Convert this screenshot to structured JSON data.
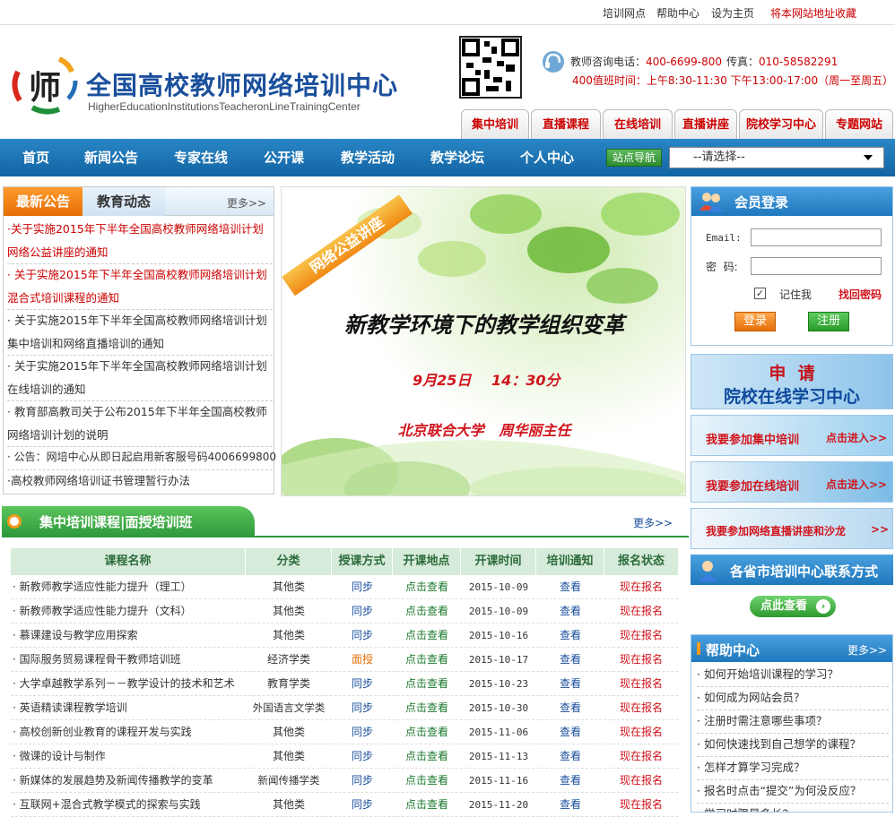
{
  "topbar": {
    "links": [
      "培训网点",
      "帮助中心",
      "设为主页"
    ],
    "bookmark": "将本网站地址收藏"
  },
  "header": {
    "logo_char": "师",
    "title": "全国高校教师网络培训中心",
    "subtitle": "HigherEducationInstitutionsTeacheronLineTrainingCenter",
    "phone_label": "教师咨询电话：",
    "phone": "400-6699-800",
    "fax_label": "传真：",
    "fax": "010-58582291",
    "hours_label": "400值班时间：",
    "hours": "上午8:30-11:30  下午13:00-17:00（周一至周五）"
  },
  "top_tabs": [
    "集中培训",
    "直播课程",
    "在线培训",
    "直播讲座",
    "院校学习中心",
    "专题网站"
  ],
  "nav": {
    "items": [
      "首页",
      "新闻公告",
      "专家在线",
      "公开课",
      "教学活动",
      "教学论坛",
      "个人中心"
    ],
    "site_nav_button": "站点导航",
    "select_value": "--请选择--"
  },
  "news": {
    "tab_active": "最新公告",
    "tab_inactive": "教育动态",
    "more": "更多>>",
    "items": [
      {
        "text": "·关于实施2015年下半年全国高校教师网络培训计划网络公益讲座的通知",
        "red": true
      },
      {
        "text": "· 关于实施2015年下半年全国高校教师网络培训计划混合式培训课程的通知",
        "red": true
      },
      {
        "text": "· 关于实施2015年下半年全国高校教师网络培训计划集中培训和网络直播培训的通知",
        "red": false
      },
      {
        "text": "· 关于实施2015年下半年全国高校教师网络培训计划在线培训的通知",
        "red": false
      },
      {
        "text": "· 教育部高教司关于公布2015年下半年全国高校教师网络培训计划的说明",
        "red": false
      },
      {
        "text": "· 公告：网培中心从即日起启用新客服号码4006699800",
        "red": false
      },
      {
        "text": "·高校教师网络培训证书管理暂行办法",
        "red": false
      }
    ]
  },
  "banner": {
    "ribbon": "网络公益讲座",
    "title": "新教学环境下的教学组织变革",
    "date": "9月25日",
    "time": "14：30分",
    "speaker": "北京联合大学   周华丽主任"
  },
  "login": {
    "title": "会员登录",
    "email_label": "Email:",
    "password_label": "密  码:",
    "remember_label": "记住我",
    "forgot_link": "找回密码",
    "login_button": "登录",
    "register_button": "注册"
  },
  "promos": {
    "apply_line1": "申  请",
    "apply_line2": "院校在线学习中心",
    "join_central": "我要参加集中培训",
    "join_online": "我要参加在线培训",
    "click_enter": "点击进入>>",
    "join_live": "我要参加网络直播讲座和沙龙",
    "arrows": ">>",
    "provinces_title": "各省市培训中心联系方式",
    "view_button": "点此查看"
  },
  "courses": {
    "heading": "集中培训课程|面授培训班",
    "more": "更多>>",
    "columns": [
      "课程名称",
      "分类",
      "授课方式",
      "开课地点",
      "开课时间",
      "培训通知",
      "报名状态"
    ],
    "rows": [
      {
        "name": "· 新教师教学适应性能力提升（理工）",
        "category": "其他类",
        "mode": "同步",
        "place": "点击查看",
        "date": "2015-10-09",
        "notice": "查看",
        "status": "现在报名"
      },
      {
        "name": "· 新教师教学适应性能力提升（文科）",
        "category": "其他类",
        "mode": "同步",
        "place": "点击查看",
        "date": "2015-10-09",
        "notice": "查看",
        "status": "现在报名"
      },
      {
        "name": "· 慕课建设与教学应用探索",
        "category": "其他类",
        "mode": "同步",
        "place": "点击查看",
        "date": "2015-10-16",
        "notice": "查看",
        "status": "现在报名"
      },
      {
        "name": "· 国际服务贸易课程骨干教师培训班",
        "category": "经济学类",
        "mode": "面授",
        "place": "点击查看",
        "date": "2015-10-17",
        "notice": "查看",
        "status": "现在报名"
      },
      {
        "name": "· 大学卓越教学系列－－教学设计的技术和艺术",
        "category": "教育学类",
        "mode": "同步",
        "place": "点击查看",
        "date": "2015-10-23",
        "notice": "查看",
        "status": "现在报名"
      },
      {
        "name": "· 英语精读课程教学培训",
        "category": "外国语言文学类",
        "mode": "同步",
        "place": "点击查看",
        "date": "2015-10-30",
        "notice": "查看",
        "status": "现在报名"
      },
      {
        "name": "· 高校创新创业教育的课程开发与实践",
        "category": "其他类",
        "mode": "同步",
        "place": "点击查看",
        "date": "2015-11-06",
        "notice": "查看",
        "status": "现在报名"
      },
      {
        "name": "· 微课的设计与制作",
        "category": "其他类",
        "mode": "同步",
        "place": "点击查看",
        "date": "2015-11-13",
        "notice": "查看",
        "status": "现在报名"
      },
      {
        "name": "· 新媒体的发展趋势及新闻传播教学的变革",
        "category": "新闻传播学类",
        "mode": "同步",
        "place": "点击查看",
        "date": "2015-11-16",
        "notice": "查看",
        "status": "现在报名"
      },
      {
        "name": "· 互联网+混合式教学模式的探索与实践",
        "category": "其他类",
        "mode": "同步",
        "place": "点击查看",
        "date": "2015-11-20",
        "notice": "查看",
        "status": "现在报名"
      }
    ]
  },
  "help": {
    "title": "帮助中心",
    "more": "更多>>",
    "items": [
      "· 如何开始培训课程的学习？",
      "· 如何成为网站会员？",
      "· 注册时需注意哪些事项？",
      "· 如何快速找到自己想学的课程？",
      "· 怎样才算学习完成？",
      "· 报名时点击“提交”为何没反应？",
      "· 学习时限是多长？"
    ]
  },
  "colors": {
    "nav_blue": "#1a72b5",
    "accent_red": "#cc0000",
    "accent_orange": "#e56e06",
    "course_green": "#2e8b3e"
  }
}
